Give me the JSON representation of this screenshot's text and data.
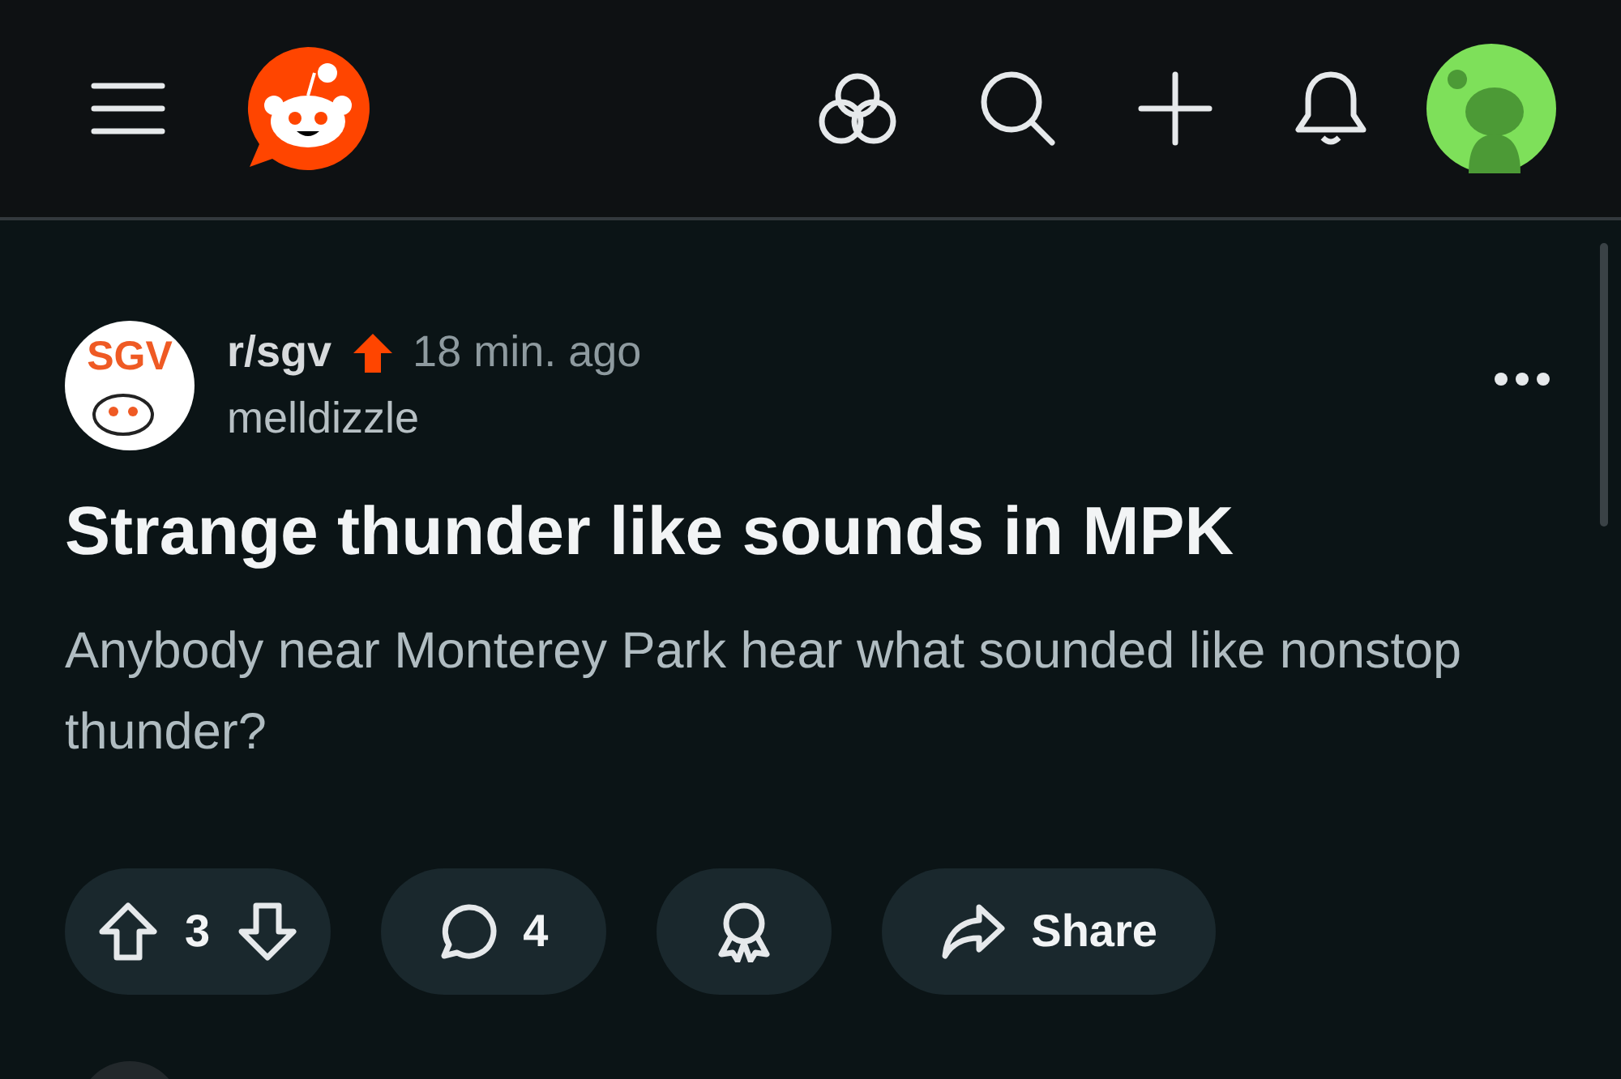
{
  "post": {
    "subreddit": "r/sgv",
    "subreddit_icon_text": "SGV",
    "time": "18 min. ago",
    "author": "melldizzle",
    "title": "Strange thunder like sounds in MPK",
    "body": "Anybody near Monterey Park hear what sounded like nonstop thunder?"
  },
  "actions": {
    "score": "3",
    "comments": "4",
    "share": "Share"
  }
}
